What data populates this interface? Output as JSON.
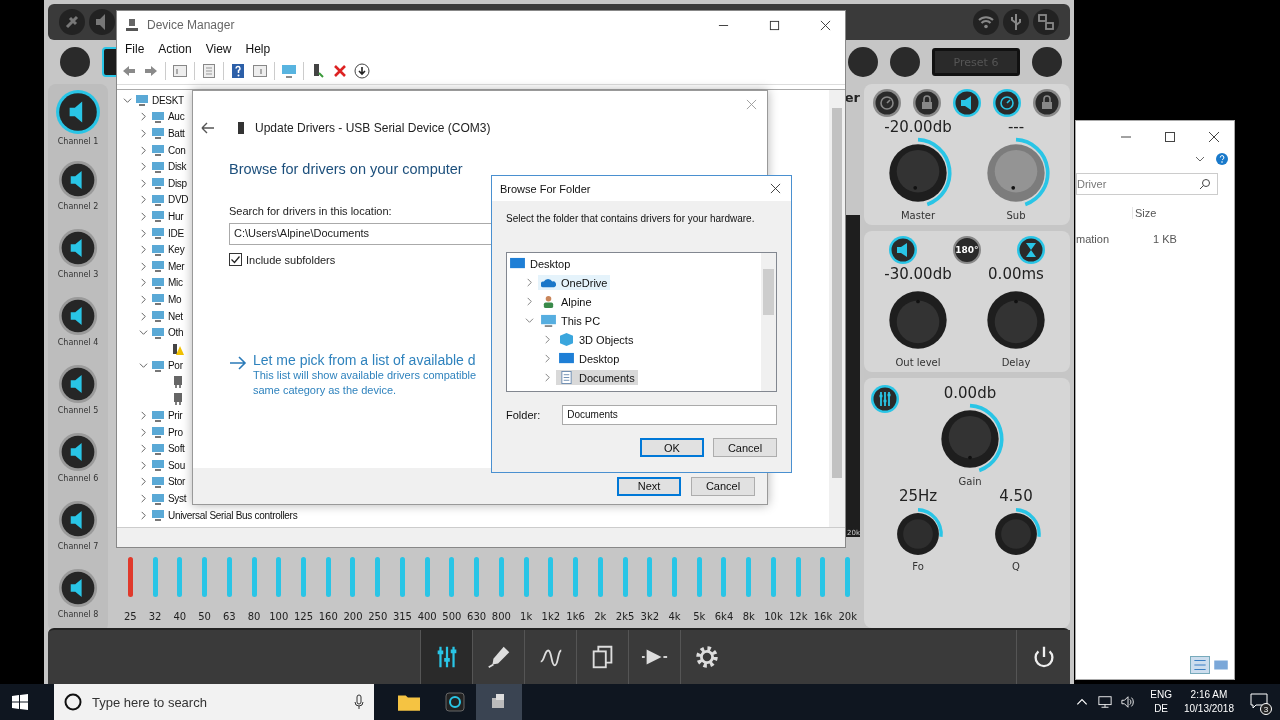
{
  "app": {
    "preset": "Preset 6",
    "channels": [
      {
        "label": "Channel 1",
        "selected": true
      },
      {
        "label": "Channel 2",
        "selected": false
      },
      {
        "label": "Channel 3",
        "selected": false
      },
      {
        "label": "Channel 4",
        "selected": false
      },
      {
        "label": "Channel 5",
        "selected": false
      },
      {
        "label": "Channel 6",
        "selected": false
      },
      {
        "label": "Channel 7",
        "selected": false
      },
      {
        "label": "Channel 8",
        "selected": false
      }
    ],
    "eq": {
      "header_fragment": "er",
      "meter_label": "20k",
      "bands": [
        {
          "label": "25",
          "color": "#e0392b"
        },
        {
          "label": "32",
          "color": "#29c5e6"
        },
        {
          "label": "40",
          "color": "#29c5e6"
        },
        {
          "label": "50",
          "color": "#29c5e6"
        },
        {
          "label": "63",
          "color": "#29c5e6"
        },
        {
          "label": "80",
          "color": "#29c5e6"
        },
        {
          "label": "100",
          "color": "#29c5e6"
        },
        {
          "label": "125",
          "color": "#29c5e6"
        },
        {
          "label": "160",
          "color": "#29c5e6"
        },
        {
          "label": "200",
          "color": "#29c5e6"
        },
        {
          "label": "250",
          "color": "#29c5e6"
        },
        {
          "label": "315",
          "color": "#29c5e6"
        },
        {
          "label": "400",
          "color": "#29c5e6"
        },
        {
          "label": "500",
          "color": "#29c5e6"
        },
        {
          "label": "630",
          "color": "#29c5e6"
        },
        {
          "label": "800",
          "color": "#29c5e6"
        },
        {
          "label": "1k",
          "color": "#29c5e6"
        },
        {
          "label": "1k2",
          "color": "#29c5e6"
        },
        {
          "label": "1k6",
          "color": "#29c5e6"
        },
        {
          "label": "2k",
          "color": "#29c5e6"
        },
        {
          "label": "2k5",
          "color": "#29c5e6"
        },
        {
          "label": "3k2",
          "color": "#29c5e6"
        },
        {
          "label": "4k",
          "color": "#29c5e6"
        },
        {
          "label": "5k",
          "color": "#29c5e6"
        },
        {
          "label": "6k4",
          "color": "#29c5e6"
        },
        {
          "label": "8k",
          "color": "#29c5e6"
        },
        {
          "label": "10k",
          "color": "#29c5e6"
        },
        {
          "label": "12k",
          "color": "#29c5e6"
        },
        {
          "label": "16k",
          "color": "#29c5e6"
        },
        {
          "label": "20k",
          "color": "#29c5e6"
        }
      ]
    },
    "output": {
      "buttons": [
        {
          "kind": "gauge",
          "active": false
        },
        {
          "kind": "lock",
          "active": false
        },
        {
          "kind": "speaker",
          "active": true
        },
        {
          "kind": "gauge",
          "active": true
        },
        {
          "kind": "lock",
          "active": false
        }
      ],
      "knobs": [
        {
          "value": "-20.00db",
          "label": "Master",
          "arc": true,
          "disabled": false
        },
        {
          "value": "---",
          "label": "Sub",
          "arc": true,
          "disabled": true
        }
      ]
    },
    "channel_out": {
      "buttons": [
        {
          "kind": "speaker",
          "active": true
        },
        {
          "kind": "phase",
          "label": "180°",
          "active": false
        },
        {
          "kind": "hourglass",
          "active": true
        }
      ],
      "knobs": [
        {
          "value": "-30.00db",
          "label": "Out level",
          "arc": false,
          "disabled": false
        },
        {
          "value": "0.00ms",
          "label": "Delay",
          "arc": false,
          "disabled": false
        }
      ]
    },
    "filter": {
      "button": {
        "active": true
      },
      "gain": {
        "value": "0.00db",
        "label": "Gain",
        "arc": true,
        "disabled": false
      },
      "knobs": [
        {
          "value": "25Hz",
          "label": "Fo",
          "arc": true,
          "disabled": false
        },
        {
          "value": "4.50",
          "label": "Q",
          "arc": true,
          "disabled": false
        }
      ]
    },
    "toolbar": [
      {
        "kind": "eq",
        "selected": true
      },
      {
        "kind": "pen",
        "selected": false
      },
      {
        "kind": "wave",
        "selected": false
      },
      {
        "kind": "copy",
        "selected": false
      },
      {
        "kind": "route",
        "selected": false
      },
      {
        "kind": "settings",
        "selected": false
      }
    ]
  },
  "explorer": {
    "search": "Driver",
    "column": "Size",
    "row": {
      "name": "mation",
      "size": "1 KB"
    }
  },
  "device_manager": {
    "title": "Device Manager",
    "menu": [
      "File",
      "Action",
      "View",
      "Help"
    ],
    "tree": [
      {
        "label": "DESKT",
        "expanded": true,
        "children": [
          {
            "label": "Auc",
            "expanded": false
          },
          {
            "label": "Batt",
            "expanded": false
          },
          {
            "label": "Con",
            "expanded": false
          },
          {
            "label": "Disk",
            "expanded": false
          },
          {
            "label": "Disp",
            "expanded": false
          },
          {
            "label": "DVD",
            "expanded": false
          },
          {
            "label": "Hur",
            "expanded": false
          },
          {
            "label": "IDE",
            "expanded": false
          },
          {
            "label": "Key",
            "expanded": false
          },
          {
            "label": "Mer",
            "expanded": false
          },
          {
            "label": "Mic",
            "expanded": false
          },
          {
            "label": "Mo",
            "expanded": false
          },
          {
            "label": "Net",
            "expanded": false
          },
          {
            "label": "Oth",
            "expanded": true,
            "children": [
              {
                "kind": "warning"
              }
            ]
          },
          {
            "label": "Por",
            "expanded": true,
            "children": [
              {
                "kind": "port"
              },
              {
                "kind": "port"
              }
            ]
          },
          {
            "label": "Prir",
            "expanded": false
          },
          {
            "label": "Pro",
            "expanded": false
          },
          {
            "label": "Soft",
            "expanded": false
          },
          {
            "label": "Sou",
            "expanded": false
          },
          {
            "label": "Stor",
            "expanded": false
          },
          {
            "label": "Syst",
            "expanded": false
          },
          {
            "label": "Universal Serial Bus controllers",
            "expanded": false
          }
        ]
      }
    ]
  },
  "update_drivers": {
    "title": "Update Drivers - USB Serial Device (COM3)",
    "heading": "Browse for drivers on your computer",
    "location_label": "Search for drivers in this location:",
    "location": "C:\\Users\\Alpine\\Documents",
    "include_subfolders": {
      "label": "Include subfolders",
      "checked": true
    },
    "pick_link": "Let me pick from a list of available d",
    "pick_desc": [
      "This list will show available drivers compatible",
      "same category as the device."
    ],
    "buttons": [
      "Next",
      "Cancel"
    ]
  },
  "browse_folder": {
    "title": "Browse For Folder",
    "prompt": "Select the folder that contains drivers for your hardware.",
    "tree": [
      {
        "label": "Desktop",
        "kind": "desktop",
        "selected": false,
        "hovered": false,
        "children": [
          {
            "label": "OneDrive",
            "kind": "cloud",
            "expanded": false,
            "selected": false,
            "hovered": true
          },
          {
            "label": "Alpine",
            "kind": "user",
            "expanded": false,
            "selected": false,
            "hovered": false
          },
          {
            "label": "This PC",
            "kind": "pc",
            "expanded": true,
            "selected": false,
            "hovered": false,
            "children": [
              {
                "label": "3D Objects",
                "kind": "cube",
                "expanded": false,
                "selected": false,
                "hovered": false
              },
              {
                "label": "Desktop",
                "kind": "desktop",
                "expanded": false,
                "selected": false,
                "hovered": false
              },
              {
                "label": "Documents",
                "kind": "document",
                "expanded": false,
                "selected": true,
                "hovered": false
              }
            ]
          }
        ]
      }
    ],
    "folder_label": "Folder:",
    "folder": "Documents",
    "buttons": [
      "OK",
      "Cancel"
    ]
  },
  "taskbar": {
    "search_placeholder": "Type here to search",
    "lang": [
      "ENG",
      "DE"
    ],
    "time": "2:16 AM",
    "date": "10/13/2018",
    "notifications": "3"
  }
}
